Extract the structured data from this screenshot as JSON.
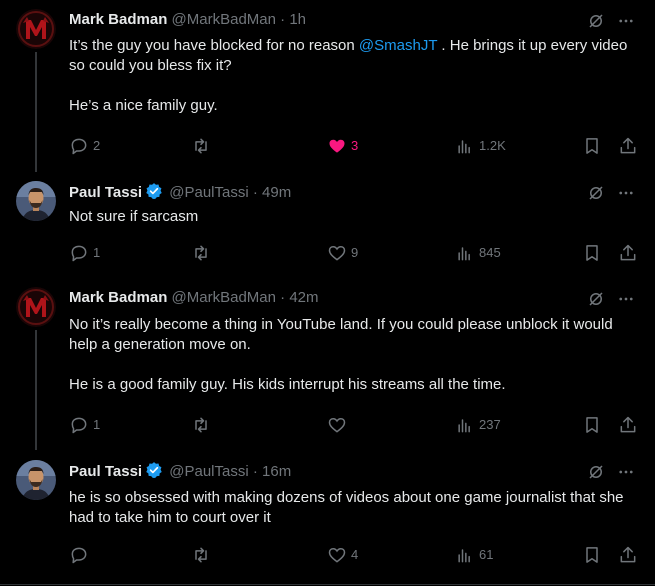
{
  "tweets": [
    {
      "name": "Mark Badman",
      "handle": "@MarkBadMan",
      "time": "1h",
      "avatar": "diablo-logo",
      "verified": false,
      "body": [
        {
          "before": "It’s the guy you have blocked for no reason ",
          "mention": "@SmashJT",
          "after": " . He brings it up every video so could you bless fix it?"
        },
        {
          "before": "He’s a nice family guy.",
          "mention": "",
          "after": ""
        }
      ],
      "replies": "2",
      "retweets": "",
      "likes": "3",
      "liked": true,
      "views": "1.2K"
    },
    {
      "name": "Paul Tassi",
      "handle": "@PaulTassi",
      "time": "49m",
      "avatar": "person",
      "verified": true,
      "body": [
        {
          "before": "Not sure if sarcasm",
          "mention": "",
          "after": ""
        }
      ],
      "replies": "1",
      "retweets": "",
      "likes": "9",
      "liked": false,
      "views": "845"
    },
    {
      "name": "Mark Badman",
      "handle": "@MarkBadMan",
      "time": "42m",
      "avatar": "diablo-logo",
      "verified": false,
      "body": [
        {
          "before": "No it’s really become a thing in YouTube land. If you could please unblock it would help a generation move on.",
          "mention": "",
          "after": ""
        },
        {
          "before": "He is a good family guy. His kids interrupt his streams all the time.",
          "mention": "",
          "after": ""
        }
      ],
      "replies": "1",
      "retweets": "",
      "likes": "",
      "liked": false,
      "views": "237"
    },
    {
      "name": "Paul Tassi",
      "handle": "@PaulTassi",
      "time": "16m",
      "avatar": "person",
      "verified": true,
      "body": [
        {
          "before": "he is so obsessed with making dozens of videos about one game journalist that she had to take him to court over it",
          "mention": "",
          "after": ""
        }
      ],
      "replies": "",
      "retweets": "",
      "likes": "4",
      "liked": false,
      "views": "61"
    }
  ],
  "separator": "·",
  "colors": {
    "background": "#000000",
    "text": "#e7e9ea",
    "muted": "#71767b",
    "accent": "#1d9bf0",
    "like": "#f91880"
  },
  "icons": [
    "grok-icon",
    "more-icon",
    "reply-icon",
    "retweet-icon",
    "like-icon",
    "views-icon",
    "bookmark-icon",
    "share-icon",
    "verified-icon"
  ]
}
